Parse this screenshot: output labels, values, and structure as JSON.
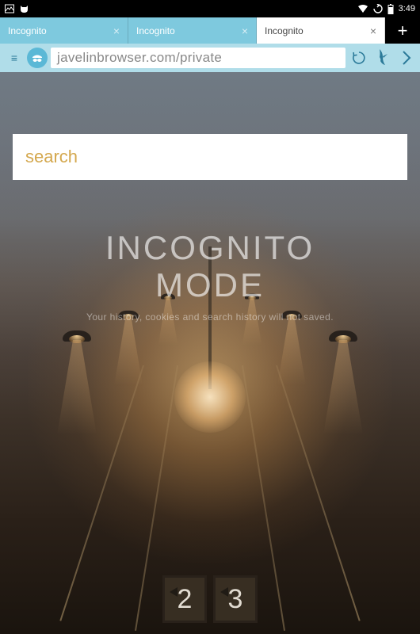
{
  "status": {
    "time": "3:49"
  },
  "tabs": [
    {
      "label": "Incognito",
      "active": false
    },
    {
      "label": "Incognito",
      "active": false
    },
    {
      "label": "Incognito",
      "active": true
    }
  ],
  "nav": {
    "url": "javelinbrowser.com/private"
  },
  "search": {
    "placeholder": "search"
  },
  "hero": {
    "title_line1": "INCOGNITO",
    "title_line2": "MODE",
    "subtitle": "Your history, cookies and search history will not saved."
  },
  "bg": {
    "sign_left": "2",
    "sign_right": "3"
  }
}
